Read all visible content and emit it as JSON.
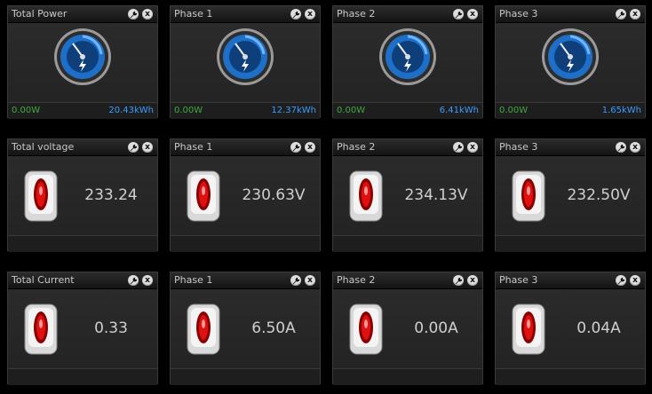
{
  "power": [
    {
      "title": "Total Power",
      "left": "0.00W",
      "right": "20.43kWh"
    },
    {
      "title": "Phase 1",
      "left": "0.00W",
      "right": "12.37kWh"
    },
    {
      "title": "Phase 2",
      "left": "0.00W",
      "right": "6.41kWh"
    },
    {
      "title": "Phase 3",
      "left": "0.00W",
      "right": "1.65kWh"
    }
  ],
  "voltage": [
    {
      "title": "Total voltage",
      "value": "233.24"
    },
    {
      "title": "Phase 1",
      "value": "230.63V"
    },
    {
      "title": "Phase 2",
      "value": "234.13V"
    },
    {
      "title": "Phase 3",
      "value": "232.50V"
    }
  ],
  "current": [
    {
      "title": "Total Current",
      "value": "0.33"
    },
    {
      "title": "Phase 1",
      "value": "6.50A"
    },
    {
      "title": "Phase 2",
      "value": "0.00A"
    },
    {
      "title": "Phase 3",
      "value": "0.04A"
    }
  ],
  "icons": {
    "settings": "wrench-icon",
    "close": "close-icon",
    "gauge": "speedometer-icon",
    "plug": "socket-icon"
  },
  "close_glyph": "x",
  "colors": {
    "footer_left": "#3eaa3e",
    "footer_right": "#3b9cff",
    "gauge_blue": "#1e6fc8"
  }
}
